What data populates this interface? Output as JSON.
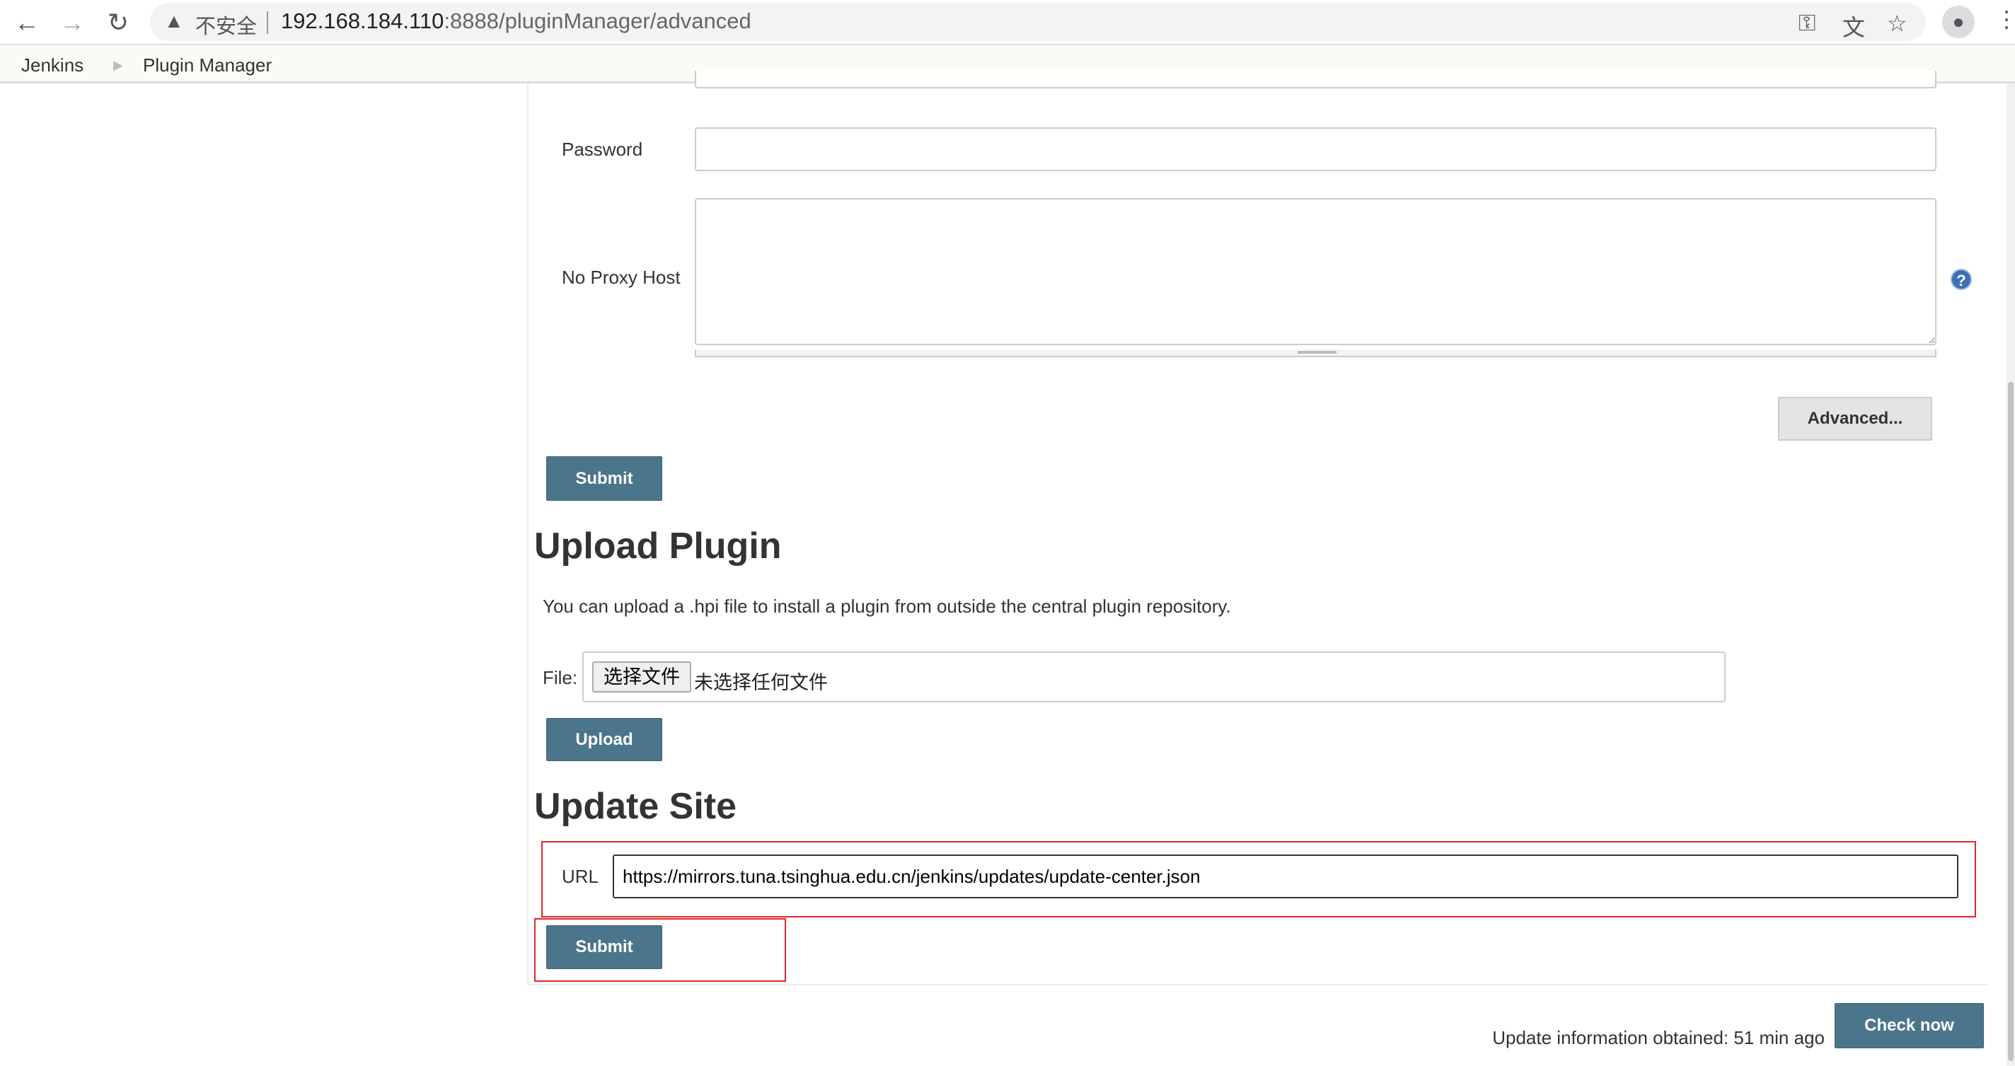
{
  "browser": {
    "insecure_label": "不安全",
    "url_host": "192.168.184.110",
    "url_rest": ":8888/pluginManager/advanced",
    "icons": [
      "back-icon",
      "forward-icon",
      "reload-icon",
      "warning-icon",
      "key-icon",
      "translate-icon",
      "star-icon",
      "profile-icon",
      "menu-icon"
    ]
  },
  "breadcrumb": {
    "items": [
      "Jenkins",
      "Plugin Manager"
    ]
  },
  "proxy": {
    "password_label": "Password",
    "password_value": "",
    "no_proxy_label": "No Proxy Host",
    "no_proxy_value": "",
    "advanced_label": "Advanced...",
    "submit_label": "Submit"
  },
  "upload": {
    "title": "Upload Plugin",
    "description": "You can upload a .hpi file to install a plugin from outside the central plugin repository.",
    "file_label": "File:",
    "choose_label": "选择文件",
    "no_file_label": "未选择任何文件",
    "upload_label": "Upload"
  },
  "update_site": {
    "title": "Update Site",
    "url_label": "URL",
    "url_value": "https://mirrors.tuna.tsinghua.edu.cn/jenkins/updates/update-center.json",
    "submit_label": "Submit"
  },
  "footer": {
    "info": "Update information obtained: 51 min ago",
    "check_now_label": "Check now"
  },
  "colors": {
    "button": "#4b758b",
    "highlight": "#e0262e",
    "breadcrumb_bg": "#f9fbf4"
  }
}
